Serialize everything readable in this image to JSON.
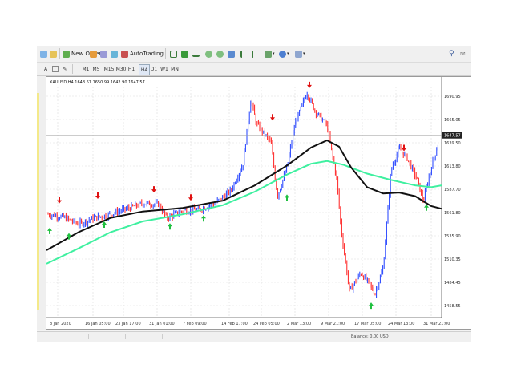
{
  "toolbar": {
    "new_order": "New Order",
    "autotrading": "AutoTrading"
  },
  "timeframes": [
    "M1",
    "M5",
    "M15",
    "M30",
    "H1",
    "H4",
    "D1",
    "W1",
    "MN"
  ],
  "active_timeframe": "H4",
  "chart": {
    "header": "XAUUSD,H4  1648.61 1650.99 1642.90 1647.57",
    "current_price": "1647.57",
    "y_ticks": [
      "1690.95",
      "1665.05",
      "1639.50",
      "1613.80",
      "1587.70",
      "1561.80",
      "1535.90",
      "1510.35",
      "1484.45",
      "1458.55"
    ],
    "x_ticks": [
      "8 Jan 2020",
      "16 Jan 05:00",
      "23 Jan 17:00",
      "31 Jan 01:00",
      "7 Feb 09:00",
      "14 Feb 17:00",
      "24 Feb 05:00",
      "2 Mar 13:00",
      "9 Mar 21:00",
      "17 Mar 05:00",
      "24 Mar 13:00",
      "31 Mar 21:00"
    ]
  },
  "status": {
    "balance_text": "Balance: 0.00 USD"
  },
  "colors": {
    "bull": "#1f3fff",
    "bear": "#ff2020",
    "ma_slow": "#111111",
    "ma_fast": "#3ff0a0",
    "arrow_up": "#20c040",
    "arrow_down": "#e01010"
  }
}
